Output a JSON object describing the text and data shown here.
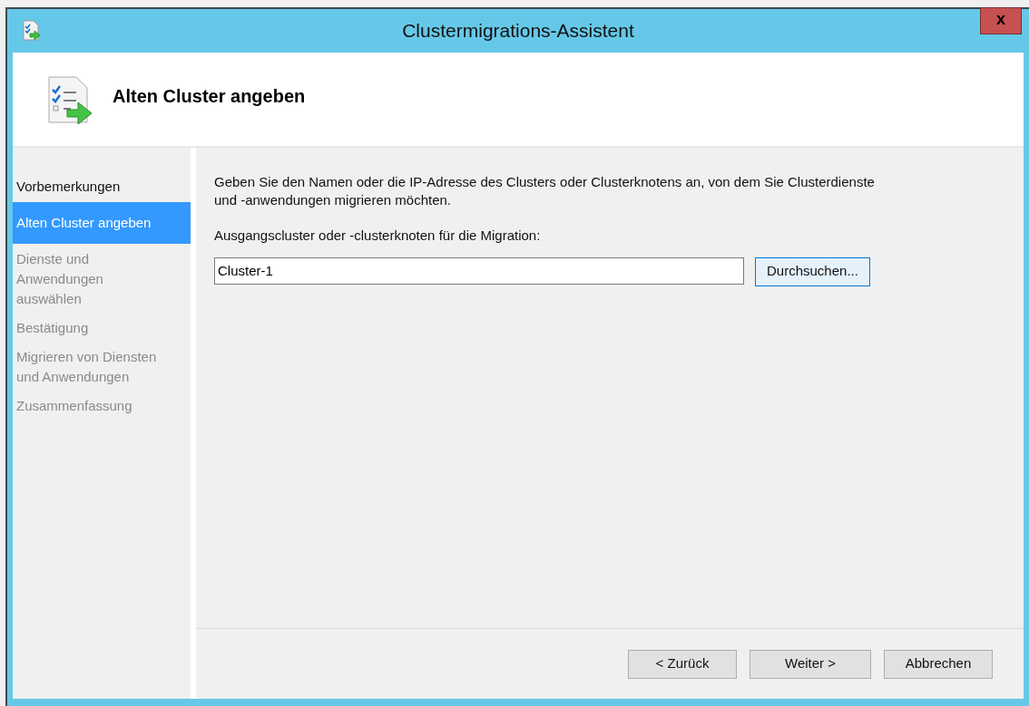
{
  "window": {
    "title": "Clustermigrations-Assistent",
    "close": "x"
  },
  "header": {
    "title": "Alten Cluster angeben"
  },
  "sidebar": {
    "items": [
      {
        "label": "Vorbemerkungen",
        "selected": false,
        "disabled": false
      },
      {
        "label": "Alten Cluster angeben",
        "selected": true,
        "disabled": false
      },
      {
        "label": "Dienste und Anwendungen auswählen",
        "selected": false,
        "disabled": true
      },
      {
        "label": "Bestätigung",
        "selected": false,
        "disabled": true
      },
      {
        "label": "Migrieren von Diensten und Anwendungen",
        "selected": false,
        "disabled": true
      },
      {
        "label": "Zusammenfassung",
        "selected": false,
        "disabled": true
      }
    ]
  },
  "content": {
    "description": "Geben Sie den Namen oder die IP-Adresse des Clusters oder Clusterknotens an, von dem Sie Clusterdienste und -anwendungen migrieren möchten.",
    "field_label": "Ausgangscluster oder -clusterknoten für die Migration:",
    "field_value": "Cluster-1",
    "browse_button": "Durchsuchen..."
  },
  "buttons": [
    "< Zurück",
    "Weiter >",
    "Abbrechen"
  ]
}
